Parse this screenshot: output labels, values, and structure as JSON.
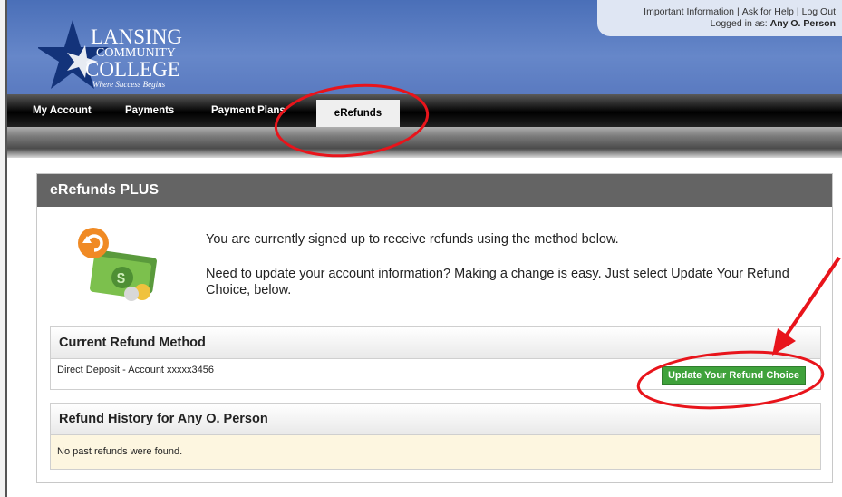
{
  "logo": {
    "line1": "LANSING",
    "line2": "COMMUNITY",
    "line3": "COLLEGE",
    "tagline": "Where Success Begins"
  },
  "utility": {
    "important_info": "Important Information",
    "help": "Ask for Help",
    "logout": "Log Out",
    "logged_in_label": "Logged in as:",
    "user": "Any O. Person"
  },
  "nav": {
    "items": [
      "My Account",
      "Payments",
      "Payment Plans",
      "eRefunds"
    ],
    "active": "eRefunds"
  },
  "card": {
    "title": "eRefunds PLUS",
    "message1": "You are currently signed up to receive refunds using the method below.",
    "message2": "Need to update your account information? Making a change is easy. Just select Update Your Refund Choice, below."
  },
  "current_method": {
    "heading": "Current Refund Method",
    "value": "Direct Deposit - Account xxxxx3456",
    "button_label": "Update Your Refund Choice"
  },
  "history": {
    "heading": "Refund History for Any O. Person",
    "empty_text": "No past refunds were found."
  },
  "colors": {
    "header_blue": "#5a7ac0",
    "button_green": "#3fa23b",
    "annotation_red": "#e8141b",
    "notice_bg": "#fdf6e0"
  }
}
